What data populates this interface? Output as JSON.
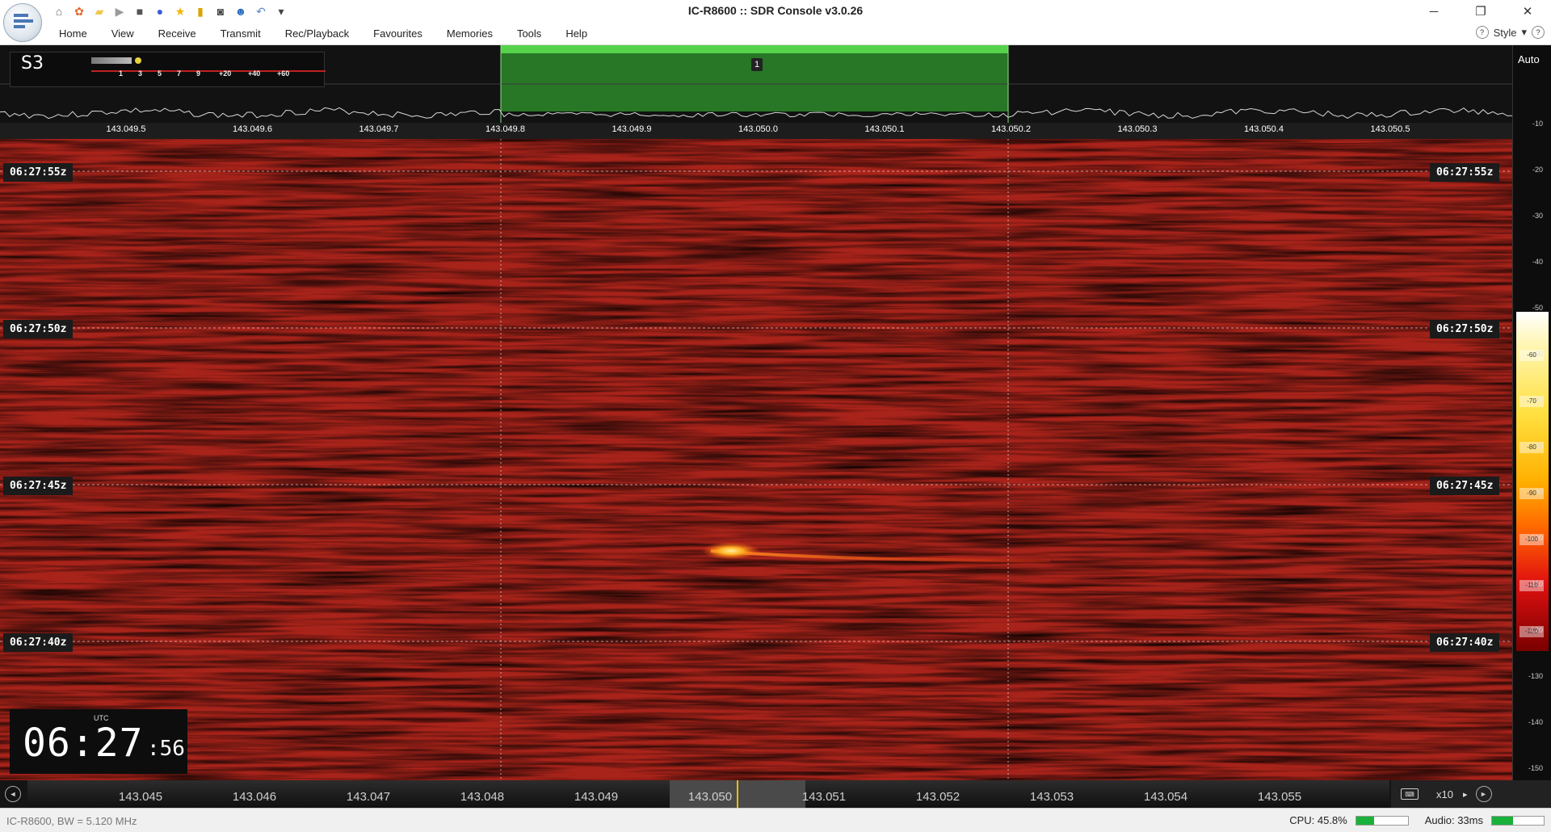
{
  "window": {
    "title": "IC-R8600 :: SDR Console v3.0.26",
    "minimize_glyph": "─",
    "restore_glyph": "❐",
    "close_glyph": "✕"
  },
  "quick_access": [
    {
      "name": "home-icon",
      "glyph": "⌂",
      "color": "#666666"
    },
    {
      "name": "settings-icon",
      "glyph": "✿",
      "color": "#e06a2a"
    },
    {
      "name": "folder-icon",
      "glyph": "▰",
      "color": "#f2c84a"
    },
    {
      "name": "play-icon",
      "glyph": "▶",
      "color": "#9a9a9a"
    },
    {
      "name": "stop-icon",
      "glyph": "■",
      "color": "#555555"
    },
    {
      "name": "record-icon",
      "glyph": "●",
      "color": "#3b5bd6"
    },
    {
      "name": "star-icon",
      "glyph": "★",
      "color": "#f2b600"
    },
    {
      "name": "lock-icon",
      "glyph": "▮",
      "color": "#d9a400"
    },
    {
      "name": "camera-icon",
      "glyph": "◙",
      "color": "#444444"
    },
    {
      "name": "user-icon",
      "glyph": "☻",
      "color": "#2a6fbf"
    },
    {
      "name": "undo-icon",
      "glyph": "↶",
      "color": "#5a87c6"
    },
    {
      "name": "customize-dropdown-icon",
      "glyph": "▾",
      "color": "#444444"
    }
  ],
  "menu": [
    "Home",
    "View",
    "Receive",
    "Transmit",
    "Rec/Playback",
    "Favourites",
    "Memories",
    "Tools",
    "Help"
  ],
  "style_menu": {
    "label": "Style",
    "caret": "▾",
    "help_glyph": "?"
  },
  "smeter": {
    "reading": "S3",
    "scale": [
      "1",
      "3",
      "5",
      "7",
      "9",
      "+20",
      "+40",
      "+60"
    ]
  },
  "spectrum": {
    "vfo_marker": "1",
    "ticks": [
      "143.049.5",
      "143.049.6",
      "143.049.7",
      "143.049.8",
      "143.049.9",
      "143.050.0",
      "143.050.1",
      "143.050.2",
      "143.050.3",
      "143.050.4",
      "143.050.5"
    ]
  },
  "db_scale": {
    "auto_label": "Auto",
    "ticks": [
      "-10",
      "-20",
      "-30",
      "-40",
      "-50",
      "-60",
      "-70",
      "-80",
      "-90",
      "-100",
      "-110",
      "-120",
      "-130",
      "-140",
      "-150"
    ],
    "chips": [
      "-60",
      "-70",
      "-80",
      "-90",
      "-100",
      "-110",
      "-120"
    ]
  },
  "waterfall": {
    "time_labels": [
      "06:27:55z",
      "06:27:50z",
      "06:27:45z",
      "06:27:40z"
    ]
  },
  "clock": {
    "zone": "UTC",
    "hours_minutes": "06:27",
    "seconds": ":56"
  },
  "frequency_bar": {
    "labels": [
      "143.045",
      "143.046",
      "143.047",
      "143.048",
      "143.049",
      "143.050",
      "143.051",
      "143.052",
      "143.053",
      "143.054",
      "143.055"
    ],
    "zoom": "x10",
    "zoom_arrow": "▸",
    "left_glyph": "◄",
    "right_glyph": "►",
    "keyboard_glyph": "⌨"
  },
  "status": {
    "left": "IC-R8600, BW = 5.120 MHz",
    "cpu_label": "CPU: 45.8%",
    "cpu_fraction": 0.35,
    "audio_label": "Audio: 33ms",
    "audio_fraction": 0.4
  },
  "colors": {
    "waterfall_base": "#9a1e14",
    "passband": "#2fbf3a",
    "signal": "#ff6a10"
  }
}
